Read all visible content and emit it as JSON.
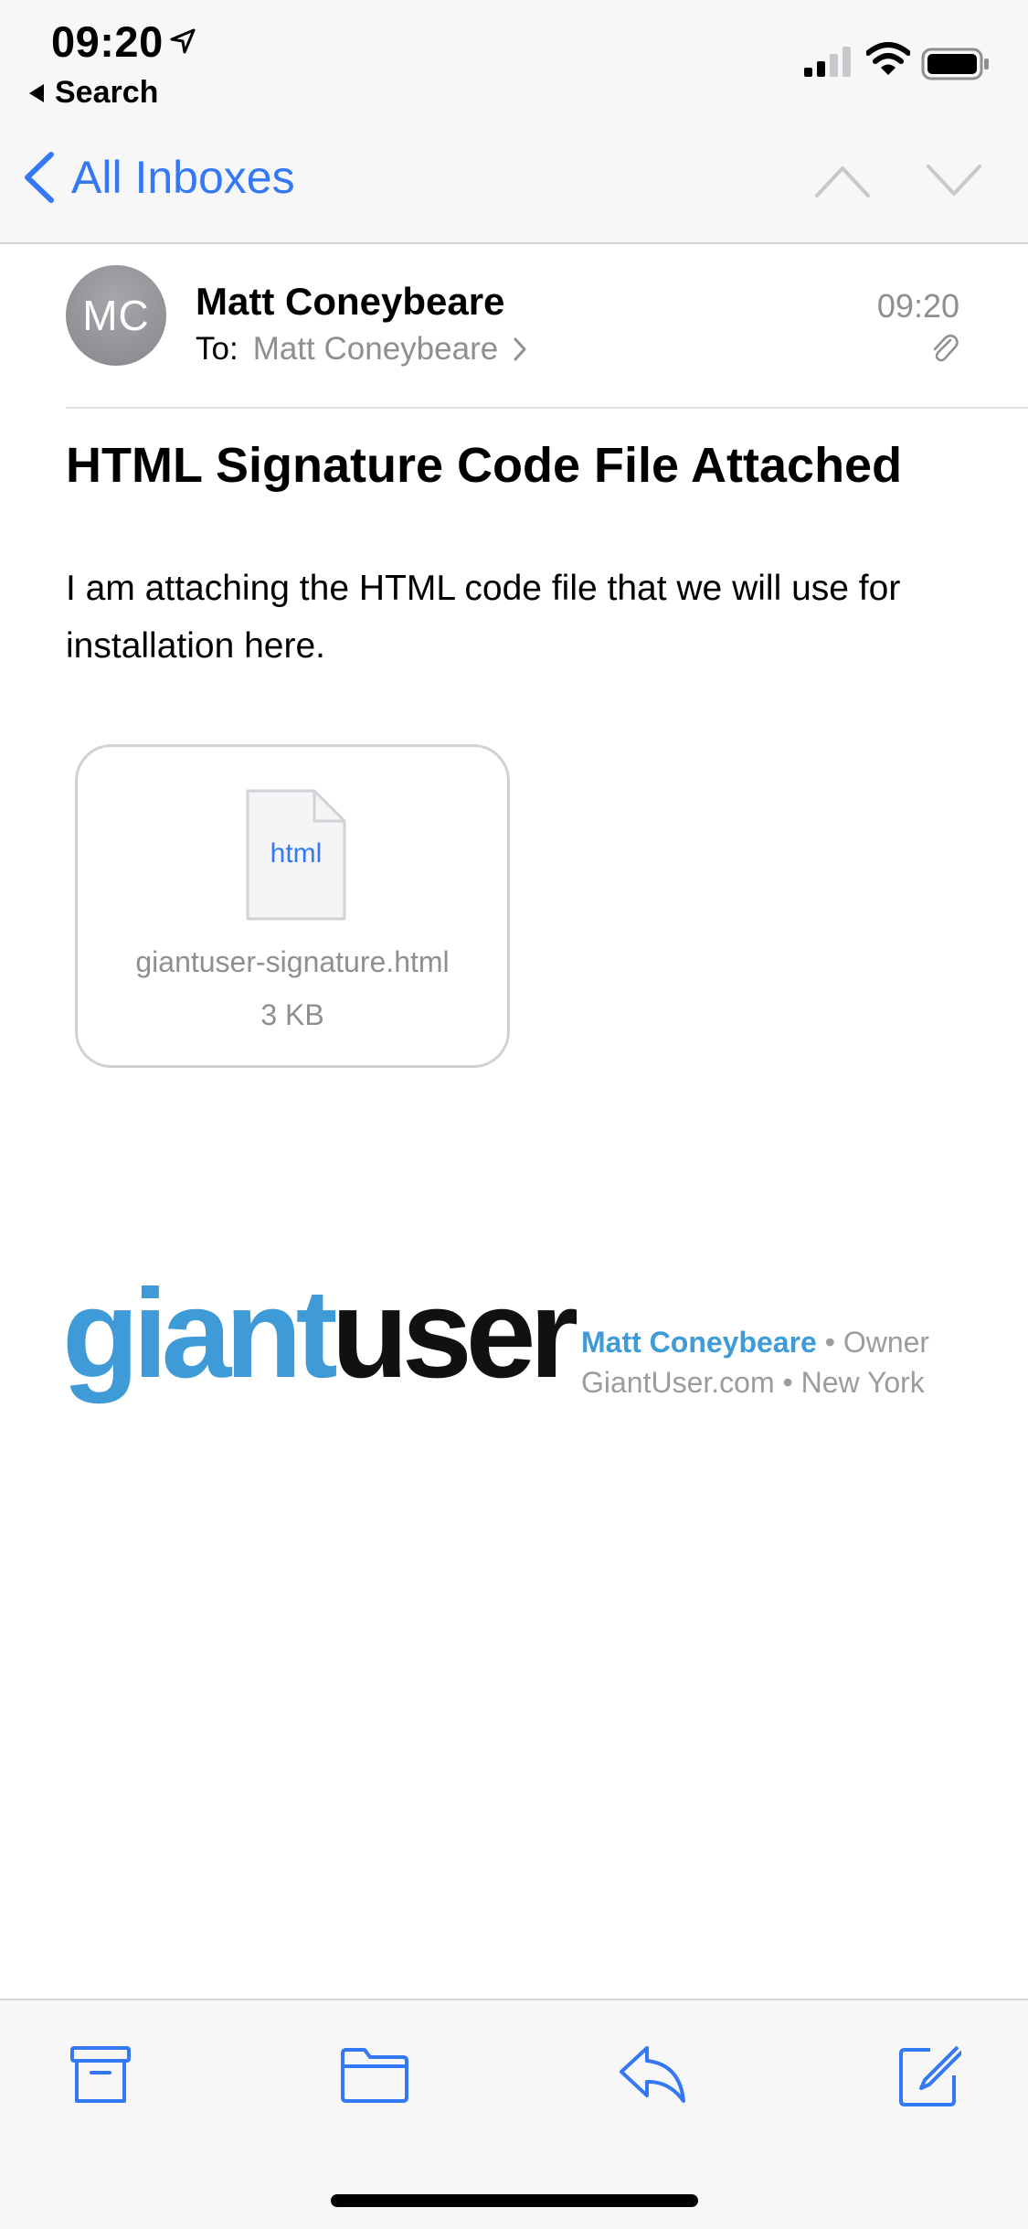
{
  "status_bar": {
    "time": "09:20",
    "back_app": "Search"
  },
  "nav": {
    "back_label": "All Inboxes"
  },
  "message": {
    "avatar_initials": "MC",
    "sender": "Matt Coneybeare",
    "to_label": "To:",
    "to_name": "Matt Coneybeare",
    "time": "09:20",
    "subject": "HTML Signature Code File Attached",
    "body": "I am attaching the HTML code file that we will use for installation here."
  },
  "attachment": {
    "file_type": "html",
    "file_name": "giantuser-signature.html",
    "file_size": "3 KB"
  },
  "signature": {
    "logo_part1": "giant",
    "logo_part2": "user",
    "name": "Matt Coneybeare",
    "separator": "•",
    "role": "Owner",
    "website": "GiantUser.com",
    "city": "New York"
  },
  "colors": {
    "accent": "#3478f6",
    "brand_blue": "#3f9ad8",
    "secondary_text": "#8e8e93"
  },
  "icons": {
    "archive": "archive-icon",
    "folder": "folder-icon",
    "reply": "reply-icon",
    "compose": "compose-icon"
  }
}
